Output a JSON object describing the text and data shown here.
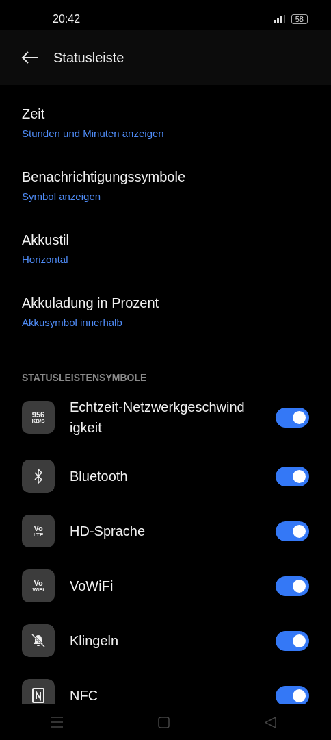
{
  "status_bar": {
    "time": "20:42",
    "battery": "58"
  },
  "header": {
    "title": "Statusleiste"
  },
  "settings": [
    {
      "title": "Zeit",
      "value": "Stunden und Minuten anzeigen"
    },
    {
      "title": "Benachrichtigungssymbole",
      "value": "Symbol anzeigen"
    },
    {
      "title": "Akkustil",
      "value": "Horizontal"
    },
    {
      "title": "Akkuladung in Prozent",
      "value": "Akkusymbol innerhalb"
    }
  ],
  "section": {
    "title": "STATUSLEISTENSYMBOLE"
  },
  "icons": [
    {
      "kind": "text",
      "badge": [
        "956",
        "KB/S"
      ],
      "label": "Echtzeit-Netzwerkgeschwind igkeit",
      "on": true
    },
    {
      "kind": "bluetooth",
      "label": "Bluetooth",
      "on": true
    },
    {
      "kind": "text",
      "badge": [
        "Vo",
        "LTE"
      ],
      "label": "HD-Sprache",
      "on": true
    },
    {
      "kind": "text",
      "badge": [
        "Vo",
        "WiFi"
      ],
      "label": "VoWiFi",
      "on": true
    },
    {
      "kind": "mute",
      "label": "Klingeln",
      "on": true
    },
    {
      "kind": "nfc",
      "label": "NFC",
      "on": true
    }
  ]
}
